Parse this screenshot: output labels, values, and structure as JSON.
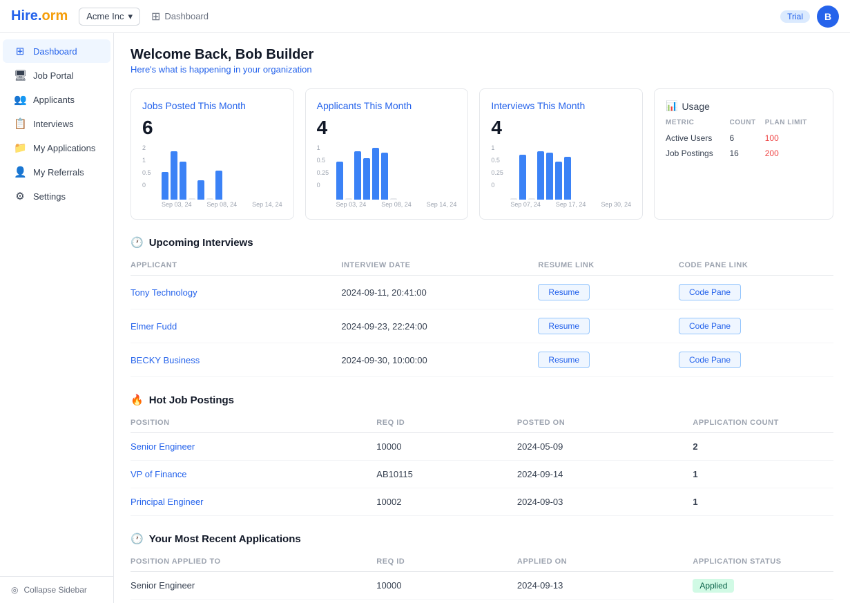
{
  "topbar": {
    "logo_hire": "Hire.",
    "logo_norm": "orm",
    "company": "Acme Inc",
    "breadcrumb_label": "Dashboard",
    "trial_label": "Trial",
    "avatar_label": "B"
  },
  "sidebar": {
    "items": [
      {
        "id": "dashboard",
        "label": "Dashboard",
        "icon": "⊞",
        "active": true
      },
      {
        "id": "job-portal",
        "label": "Job Portal",
        "icon": "🖥",
        "active": false
      },
      {
        "id": "applicants",
        "label": "Applicants",
        "icon": "👥",
        "active": false
      },
      {
        "id": "interviews",
        "label": "Interviews",
        "icon": "📋",
        "active": false
      },
      {
        "id": "my-applications",
        "label": "My Applications",
        "icon": "📁",
        "active": false
      },
      {
        "id": "my-referrals",
        "label": "My Referrals",
        "icon": "👤",
        "active": false
      },
      {
        "id": "settings",
        "label": "Settings",
        "icon": "⚙",
        "active": false
      }
    ],
    "collapse_label": "Collapse Sidebar"
  },
  "main": {
    "welcome": "Welcome Back, Bob Builder",
    "subtitle": "Here's what is happening in your organization",
    "jobs_card": {
      "title": "Jobs Posted This Month",
      "count": "6",
      "bars": [
        40,
        80,
        60,
        0,
        30,
        0,
        50
      ],
      "y_labels": [
        "2",
        "1",
        "0.5",
        "0"
      ],
      "x_labels": [
        "Sep 03, 24",
        "Sep 08, 24",
        "Sep 14, 24"
      ]
    },
    "applicants_card": {
      "title": "Applicants This Month",
      "count": "4",
      "bars": [
        50,
        0,
        70,
        60,
        80,
        75,
        0
      ],
      "y_labels": [
        "1",
        "0.5",
        "0.25",
        "0"
      ],
      "x_labels": [
        "Sep 03, 24",
        "Sep 08, 24",
        "Sep 14, 24"
      ]
    },
    "interviews_card": {
      "title": "Interviews This Month",
      "count": "4",
      "bars": [
        0,
        60,
        0,
        70,
        65,
        55,
        60
      ],
      "y_labels": [
        "1",
        "0.5",
        "0.25",
        "0"
      ],
      "x_labels": [
        "Sep 07, 24",
        "Sep 17, 24",
        "Sep 30, 24"
      ]
    },
    "usage_card": {
      "title": "Usage",
      "metrics": [
        {
          "metric": "Active Users",
          "count": "6",
          "limit": "100"
        },
        {
          "metric": "Job Postings",
          "count": "16",
          "limit": "200"
        }
      ],
      "col_metric": "METRIC",
      "col_count": "COUNT",
      "col_limit": "PLAN LIMIT"
    },
    "upcoming_interviews": {
      "title": "Upcoming Interviews",
      "col_applicant": "APPLICANT",
      "col_date": "INTERVIEW DATE",
      "col_resume": "RESUME LINK",
      "col_code": "CODE PANE LINK",
      "rows": [
        {
          "name": "Tony Technology",
          "date": "2024-09-11, 20:41:00",
          "resume": "Resume",
          "code": "Code Pane"
        },
        {
          "name": "Elmer Fudd",
          "date": "2024-09-23, 22:24:00",
          "resume": "Resume",
          "code": "Code Pane"
        },
        {
          "name": "BECKY Business",
          "date": "2024-09-30, 10:00:00",
          "resume": "Resume",
          "code": "Code Pane"
        }
      ]
    },
    "hot_job_postings": {
      "title": "Hot Job Postings",
      "col_position": "POSITION",
      "col_req": "REQ ID",
      "col_posted": "POSTED ON",
      "col_count": "APPLICATION COUNT",
      "rows": [
        {
          "position": "Senior Engineer",
          "req_id": "10000",
          "posted_on": "2024-05-09",
          "count": "2"
        },
        {
          "position": "VP of Finance",
          "req_id": "AB10115",
          "posted_on": "2024-09-14",
          "count": "1"
        },
        {
          "position": "Principal Engineer",
          "req_id": "10002",
          "posted_on": "2024-09-03",
          "count": "1"
        }
      ]
    },
    "recent_applications": {
      "title": "Your Most Recent Applications",
      "col_position": "POSITION APPLIED TO",
      "col_req": "REQ ID",
      "col_applied": "APPLIED ON",
      "col_status": "APPLICATION STATUS",
      "rows": [
        {
          "position": "Senior Engineer",
          "req_id": "10000",
          "applied_on": "2024-09-13",
          "status": "Applied"
        }
      ]
    }
  }
}
